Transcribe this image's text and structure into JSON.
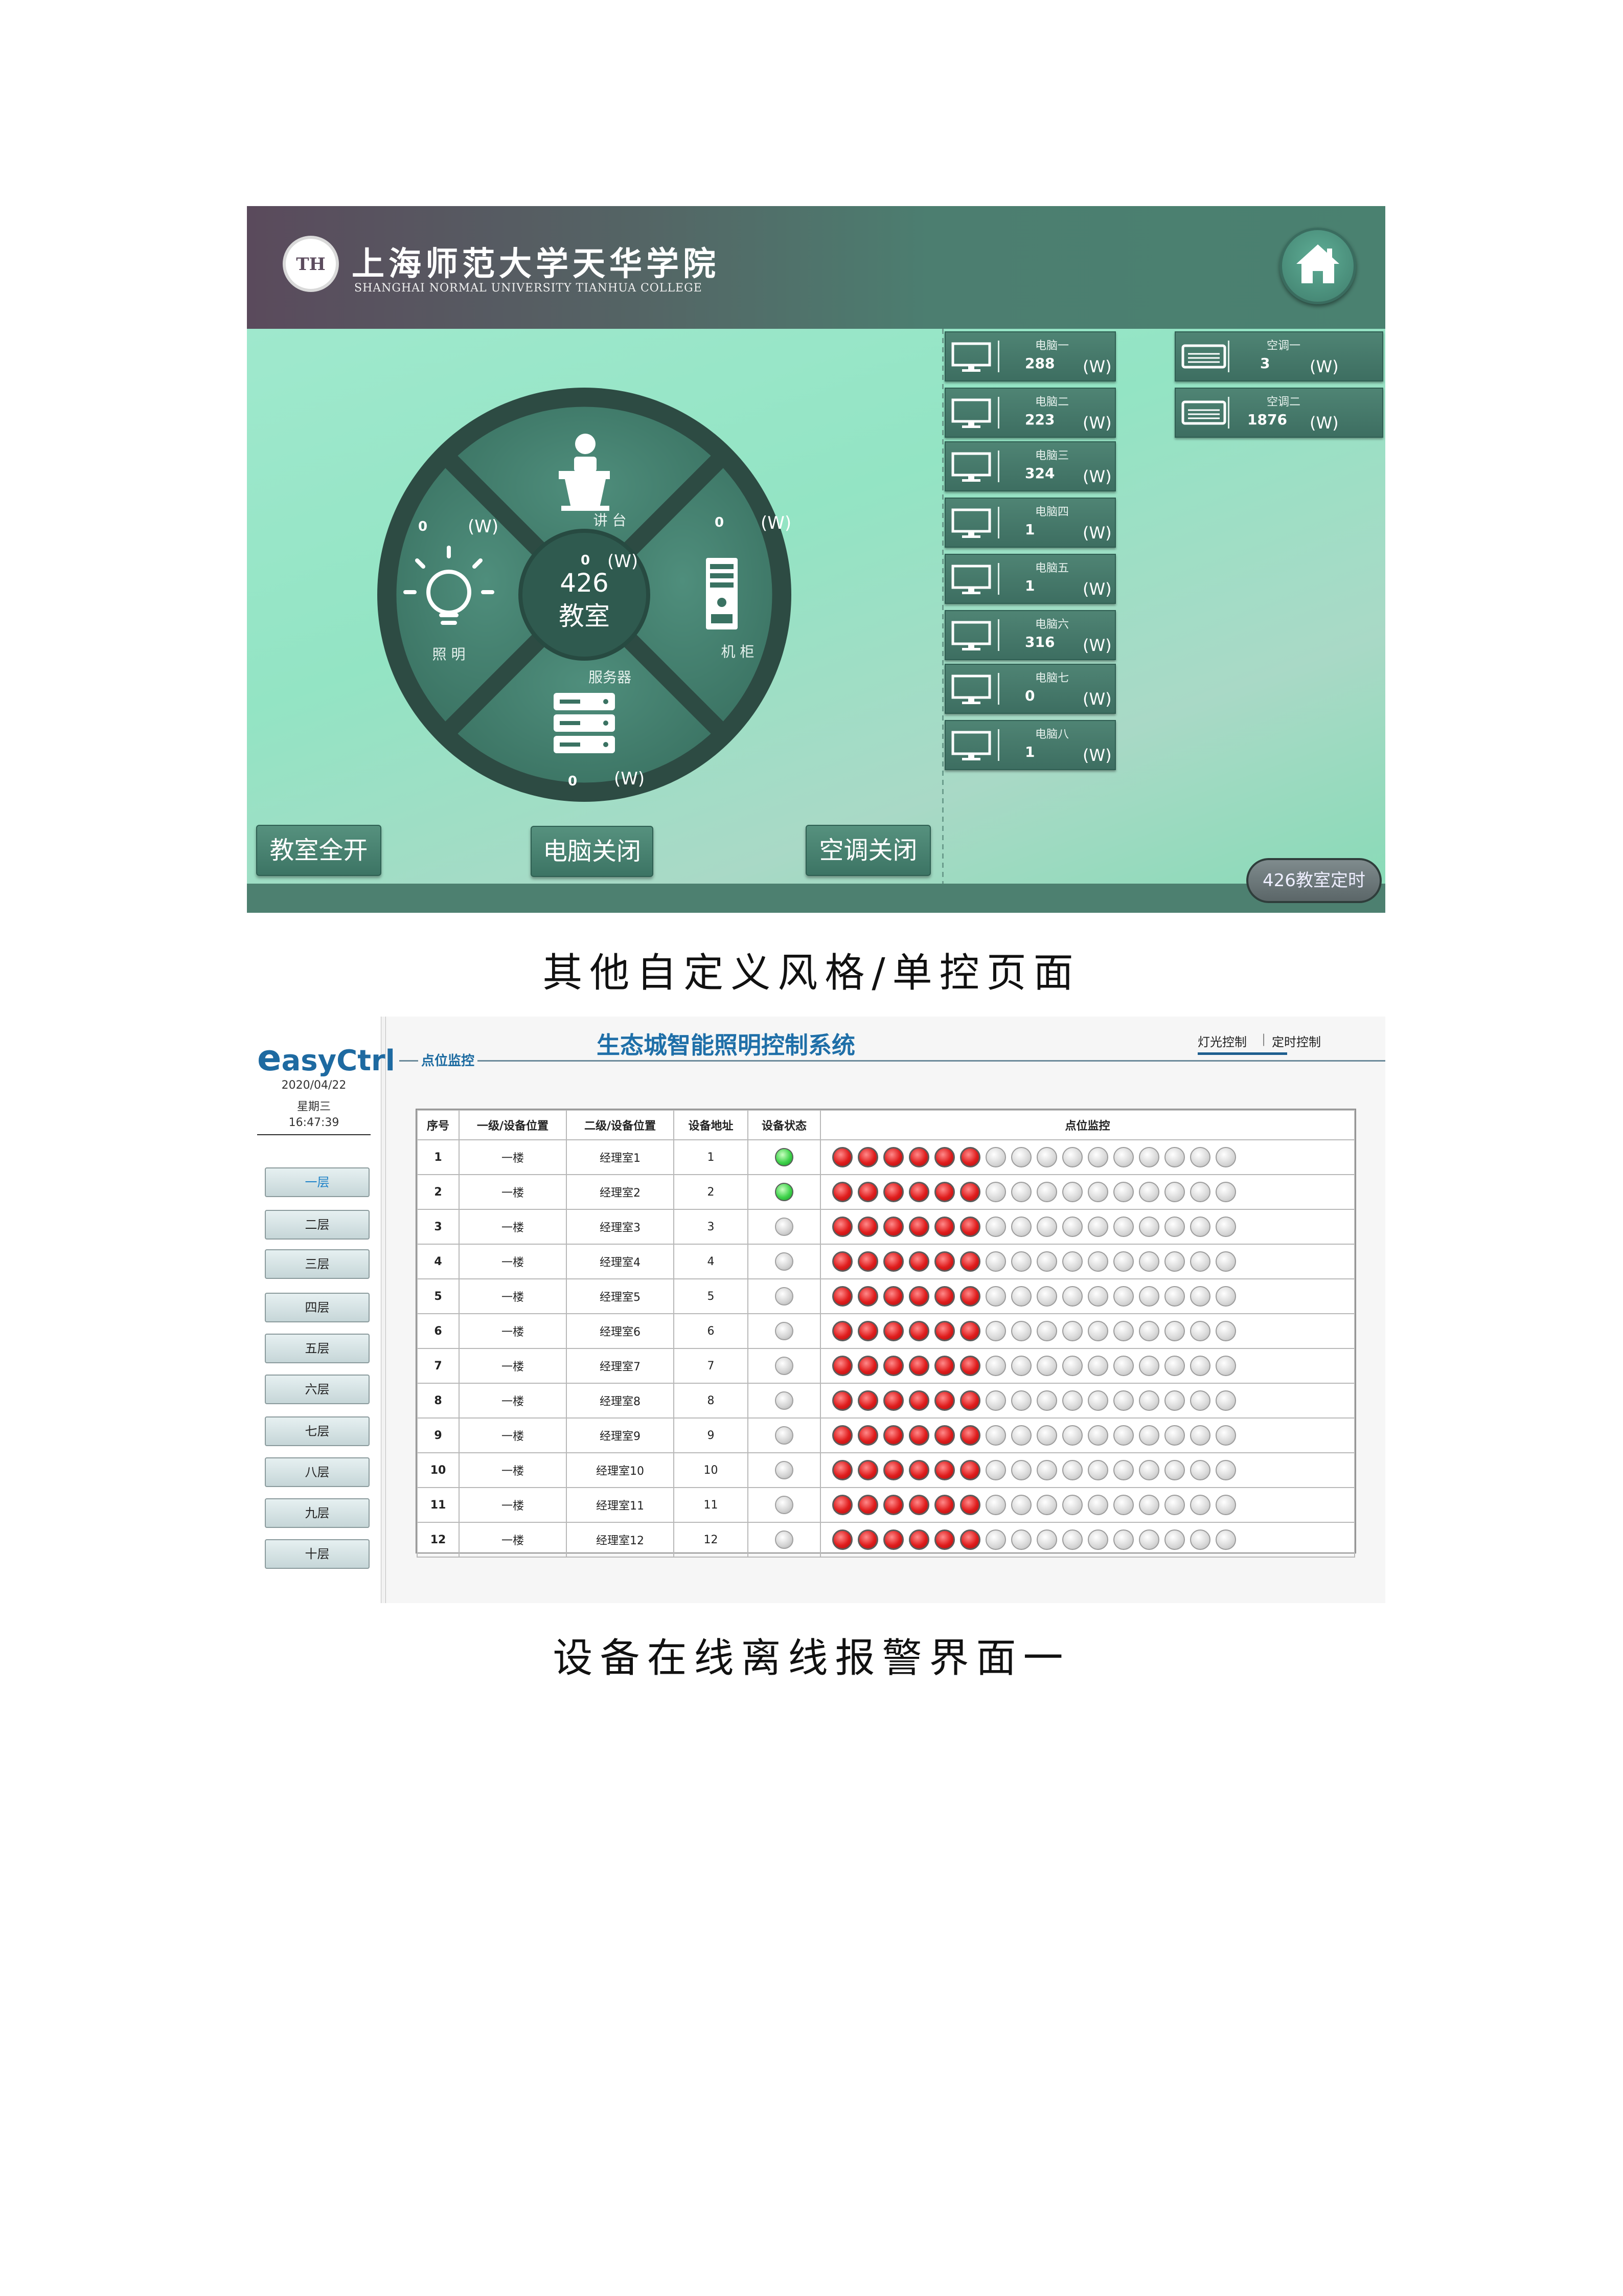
{
  "screen1": {
    "school_name": "上海师范大学天华学院",
    "school_name_en": "SHANGHAI NORMAL UNIVERSITY TIANHUA COLLEGE",
    "center": {
      "number": "426",
      "name": "教室"
    },
    "segments": {
      "podium": {
        "label": "讲 台",
        "value": "0",
        "unit": "(W)"
      },
      "lighting": {
        "label": "照 明",
        "value": "0",
        "unit": "(W)"
      },
      "cabinet": {
        "label": "机 柜",
        "value": "0",
        "unit": "(W)"
      },
      "server": {
        "label": "服务器",
        "value": "0",
        "unit": "(W)"
      }
    },
    "computers": [
      {
        "name": "电脑一",
        "value": "288",
        "unit": "(W)"
      },
      {
        "name": "电脑二",
        "value": "223",
        "unit": "(W)"
      },
      {
        "name": "电脑三",
        "value": "324",
        "unit": "(W)"
      },
      {
        "name": "电脑四",
        "value": "1",
        "unit": "(W)"
      },
      {
        "name": "电脑五",
        "value": "1",
        "unit": "(W)"
      },
      {
        "name": "电脑六",
        "value": "316",
        "unit": "(W)"
      },
      {
        "name": "电脑七",
        "value": "0",
        "unit": "(W)"
      },
      {
        "name": "电脑八",
        "value": "1",
        "unit": "(W)"
      }
    ],
    "aircons": [
      {
        "name": "空调一",
        "value": "3",
        "unit": "(W)"
      },
      {
        "name": "空调二",
        "value": "1876",
        "unit": "(W)"
      }
    ],
    "buttons": {
      "all_on": "教室全开",
      "pc_off": "电脑关闭",
      "ac_off": "空调关闭",
      "timer": "426教室定时"
    }
  },
  "caption1": "其他自定义风格/单控页面",
  "screen2": {
    "logo_e": "e",
    "logo_rest": "asyCtrl",
    "date": "2020/04/22",
    "weekday": "星期三",
    "time": "16:47:39",
    "floors": [
      "一层",
      "二层",
      "三层",
      "四层",
      "五层",
      "六层",
      "七层",
      "八层",
      "九层",
      "十层"
    ],
    "title": "生态城智能照明控制系统",
    "tabs": [
      "灯光控制",
      "定时控制"
    ],
    "section_label": "点位监控",
    "columns": [
      "序号",
      "一级/设备位置",
      "二级/设备位置",
      "设备地址",
      "设备状态",
      "点位监控"
    ],
    "rows": [
      {
        "no": "1",
        "lvl1": "一楼",
        "lvl2": "经理室1",
        "addr": "1",
        "online": true
      },
      {
        "no": "2",
        "lvl1": "一楼",
        "lvl2": "经理室2",
        "addr": "2",
        "online": true
      },
      {
        "no": "3",
        "lvl1": "一楼",
        "lvl2": "经理室3",
        "addr": "3",
        "online": false
      },
      {
        "no": "4",
        "lvl1": "一楼",
        "lvl2": "经理室4",
        "addr": "4",
        "online": false
      },
      {
        "no": "5",
        "lvl1": "一楼",
        "lvl2": "经理室5",
        "addr": "5",
        "online": false
      },
      {
        "no": "6",
        "lvl1": "一楼",
        "lvl2": "经理室6",
        "addr": "6",
        "online": false
      },
      {
        "no": "7",
        "lvl1": "一楼",
        "lvl2": "经理室7",
        "addr": "7",
        "online": false
      },
      {
        "no": "8",
        "lvl1": "一楼",
        "lvl2": "经理室8",
        "addr": "8",
        "online": false
      },
      {
        "no": "9",
        "lvl1": "一楼",
        "lvl2": "经理室9",
        "addr": "9",
        "online": false
      },
      {
        "no": "10",
        "lvl1": "一楼",
        "lvl2": "经理室10",
        "addr": "10",
        "online": false
      },
      {
        "no": "11",
        "lvl1": "一楼",
        "lvl2": "经理室11",
        "addr": "11",
        "online": false
      },
      {
        "no": "12",
        "lvl1": "一楼",
        "lvl2": "经理室12",
        "addr": "12",
        "online": false
      }
    ],
    "points_on": 6,
    "points_total": 16
  },
  "caption2": "设备在线离线报警界面一"
}
